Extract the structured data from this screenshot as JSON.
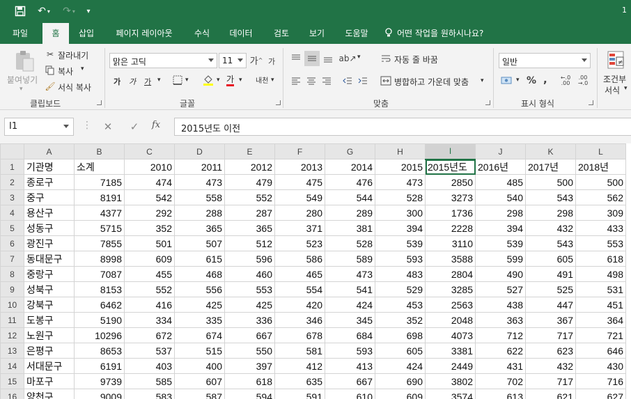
{
  "title_bar": {
    "right_text": "1",
    "quick_access": [
      "save-icon",
      "undo-icon",
      "redo-icon",
      "customize-qat-icon"
    ]
  },
  "tabs": [
    {
      "label": "파일"
    },
    {
      "label": "홈"
    },
    {
      "label": "삽입"
    },
    {
      "label": "페이지 레이아웃"
    },
    {
      "label": "수식"
    },
    {
      "label": "데이터"
    },
    {
      "label": "검토"
    },
    {
      "label": "보기"
    },
    {
      "label": "도움말"
    },
    {
      "label": "어떤 작업을 원하시나요?"
    }
  ],
  "active_tab": "홈",
  "ribbon": {
    "clipboard": {
      "paste": "붙여넣기",
      "cut": "잘라내기",
      "copy": "복사",
      "format_painter": "서식 복사",
      "label": "클립보드"
    },
    "font": {
      "font_name": "맑은 고딕",
      "font_size": "11",
      "bold": "가",
      "italic": "가",
      "underline": "가",
      "font_color": "가",
      "phonetic": "내천",
      "label": "글꼴"
    },
    "alignment": {
      "wrap_text": "자동 줄 바꿈",
      "merge_center": "병합하고 가운데 맞춤",
      "label": "맞춤"
    },
    "number": {
      "format": "일반",
      "percent": "%",
      "comma": ",",
      "label": "표시 형식"
    },
    "styles": {
      "conditional_line1": "조건부",
      "conditional_line2": "서식"
    }
  },
  "formula_bar": {
    "name_box": "I1",
    "fx": "fx",
    "content": "2015년도 이전"
  },
  "sheet": {
    "columns": [
      "A",
      "B",
      "C",
      "D",
      "E",
      "F",
      "G",
      "H",
      "I",
      "J",
      "K",
      "L"
    ],
    "selected_column": "I",
    "active_cell": "I1",
    "rows": [
      {
        "n": "1",
        "cells": [
          "기관명",
          "소계",
          "2010",
          "2011",
          "2012",
          "2013",
          "2014",
          "2015",
          "2015년도",
          "2016년",
          "2017년",
          "2018년"
        ]
      },
      {
        "n": "2",
        "cells": [
          "종로구",
          "7185",
          "474",
          "473",
          "479",
          "475",
          "476",
          "473",
          "2850",
          "485",
          "500",
          "500"
        ]
      },
      {
        "n": "3",
        "cells": [
          "중구",
          "8191",
          "542",
          "558",
          "552",
          "549",
          "544",
          "528",
          "3273",
          "540",
          "543",
          "562"
        ]
      },
      {
        "n": "4",
        "cells": [
          "용산구",
          "4377",
          "292",
          "288",
          "287",
          "280",
          "289",
          "300",
          "1736",
          "298",
          "298",
          "309"
        ]
      },
      {
        "n": "5",
        "cells": [
          "성동구",
          "5715",
          "352",
          "365",
          "365",
          "371",
          "381",
          "394",
          "2228",
          "394",
          "432",
          "433"
        ]
      },
      {
        "n": "6",
        "cells": [
          "광진구",
          "7855",
          "501",
          "507",
          "512",
          "523",
          "528",
          "539",
          "3110",
          "539",
          "543",
          "553"
        ]
      },
      {
        "n": "7",
        "cells": [
          "동대문구",
          "8998",
          "609",
          "615",
          "596",
          "586",
          "589",
          "593",
          "3588",
          "599",
          "605",
          "618"
        ]
      },
      {
        "n": "8",
        "cells": [
          "중랑구",
          "7087",
          "455",
          "468",
          "460",
          "465",
          "473",
          "483",
          "2804",
          "490",
          "491",
          "498"
        ]
      },
      {
        "n": "9",
        "cells": [
          "성북구",
          "8153",
          "552",
          "556",
          "553",
          "554",
          "541",
          "529",
          "3285",
          "527",
          "525",
          "531"
        ]
      },
      {
        "n": "10",
        "cells": [
          "강북구",
          "6462",
          "416",
          "425",
          "425",
          "420",
          "424",
          "453",
          "2563",
          "438",
          "447",
          "451"
        ]
      },
      {
        "n": "11",
        "cells": [
          "도봉구",
          "5190",
          "334",
          "335",
          "336",
          "346",
          "345",
          "352",
          "2048",
          "363",
          "367",
          "364"
        ]
      },
      {
        "n": "12",
        "cells": [
          "노원구",
          "10296",
          "672",
          "674",
          "667",
          "678",
          "684",
          "698",
          "4073",
          "712",
          "717",
          "721"
        ]
      },
      {
        "n": "13",
        "cells": [
          "은평구",
          "8653",
          "537",
          "515",
          "550",
          "581",
          "593",
          "605",
          "3381",
          "622",
          "623",
          "646"
        ]
      },
      {
        "n": "14",
        "cells": [
          "서대문구",
          "6191",
          "403",
          "400",
          "397",
          "412",
          "413",
          "424",
          "2449",
          "431",
          "432",
          "430"
        ]
      },
      {
        "n": "15",
        "cells": [
          "마포구",
          "9739",
          "585",
          "607",
          "618",
          "635",
          "667",
          "690",
          "3802",
          "702",
          "717",
          "716"
        ]
      },
      {
        "n": "16",
        "cells": [
          "양천구",
          "9009",
          "583",
          "587",
          "594",
          "591",
          "610",
          "609",
          "3574",
          "613",
          "621",
          "627"
        ]
      }
    ]
  }
}
